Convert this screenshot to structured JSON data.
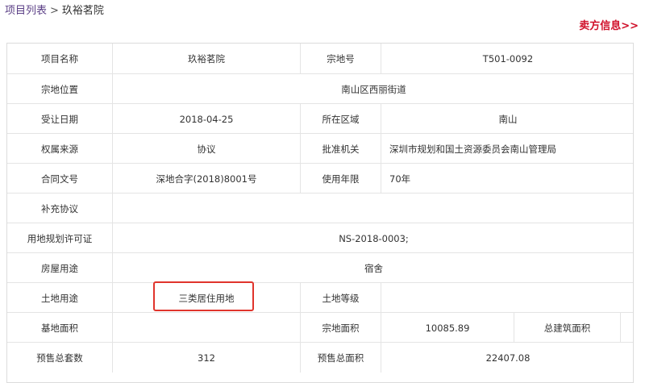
{
  "breadcrumb": {
    "parent": "项目列表",
    "separator": ">",
    "current": "玖裕茗院"
  },
  "seller_link": "卖方信息>>",
  "colors": {
    "seller_link": "#d0102a",
    "highlight_border": "#e0342c",
    "breadcrumb_link": "#5a3e85"
  },
  "table": {
    "project_name_label": "项目名称",
    "project_name": "玖裕茗院",
    "parcel_no_label": "宗地号",
    "parcel_no": "T501-0092",
    "parcel_location_label": "宗地位置",
    "parcel_location": "南山区西丽街道",
    "transfer_date_label": "受让日期",
    "transfer_date": "2018-04-25",
    "district_label": "所在区域",
    "district": "南山",
    "ownership_source_label": "权属来源",
    "ownership_source": "协议",
    "approval_authority_label": "批准机关",
    "approval_authority": "深圳市规划和国土资源委员会南山管理局",
    "contract_no_label": "合同文号",
    "contract_no": "深地合字(2018)8001号",
    "use_years_label": "使用年限",
    "use_years": "70年",
    "supplement_label": "补充协议",
    "supplement": "",
    "land_permit_label": "用地规划许可证",
    "land_permit": "NS-2018-0003;",
    "building_use_label": "房屋用途",
    "building_use": "宿舍",
    "land_use_label": "土地用途",
    "land_use": "三类居住用地",
    "land_grade_label": "土地等级",
    "land_grade": "",
    "base_area_label": "基地面积",
    "base_area": "",
    "parcel_area_label": "宗地面积",
    "parcel_area": "10085.89",
    "total_floor_area_label": "总建筑面积",
    "total_floor_area": "",
    "presale_units_label": "预售总套数",
    "presale_units": "312",
    "presale_area_label": "预售总面积",
    "presale_area": "22407.08"
  }
}
